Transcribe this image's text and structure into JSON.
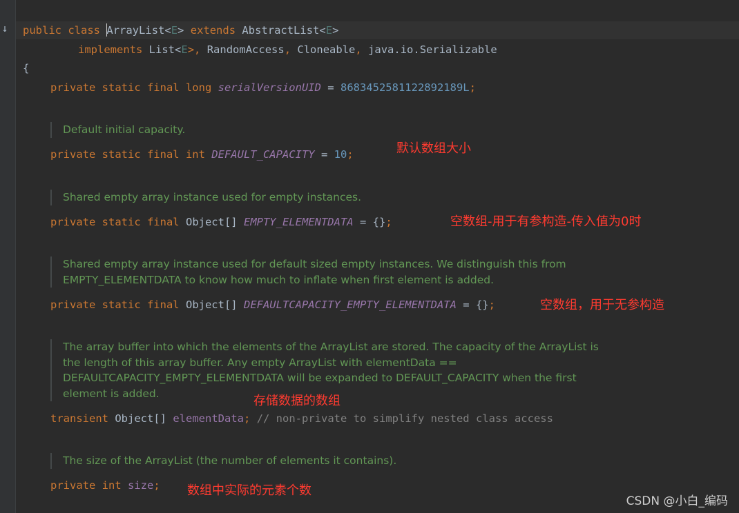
{
  "code": {
    "class_decl": {
      "public": "public",
      "class": "class",
      "name_first_char": "A",
      "name_rest": "rrayList",
      "lt1": "<",
      "type_param1": "E",
      "gt1": ">",
      "extends": "extends",
      "superclass": "AbstractList",
      "lt2": "<",
      "type_param2": "E",
      "gt2": ">"
    },
    "implements_line": {
      "implements": "implements",
      "list": "List",
      "lt": "<",
      "type_param": "E",
      "gt_comma": ">,",
      "random_access": "RandomAccess",
      "comma2": ",",
      "cloneable": "Cloneable",
      "comma3": ",",
      "serializable": "java.io.Serializable"
    },
    "open_brace": "{",
    "serial_line": {
      "modifiers": "private static final long",
      "name": "serialVersionUID",
      "eq": "=",
      "value": "8683452581122892189L",
      "semi": ";"
    },
    "doc_default_capacity": [
      "Default initial capacity."
    ],
    "default_capacity_line": {
      "modifiers": "private static final int",
      "name": "DEFAULT_CAPACITY",
      "eq": "=",
      "value": "10",
      "semi": ";"
    },
    "doc_empty": [
      "Shared empty array instance used for empty instances."
    ],
    "empty_line": {
      "modifiers": "private static final",
      "type": "Object[]",
      "name": "EMPTY_ELEMENTDATA",
      "eq": "=",
      "value": "{}",
      "semi": ";"
    },
    "doc_default_empty": [
      "Shared empty array instance used for default sized empty instances. We distinguish this from",
      "EMPTY_ELEMENTDATA to know how much to inflate when first element is added."
    ],
    "default_empty_line": {
      "modifiers": "private static final",
      "type": "Object[]",
      "name": "DEFAULTCAPACITY_EMPTY_ELEMENTDATA",
      "eq": "=",
      "value": "{}",
      "semi": ";"
    },
    "doc_element_data": [
      "The array buffer into which the elements of the ArrayList are stored. The capacity of the ArrayList is",
      "the length of this array buffer. Any empty ArrayList with elementData ==",
      "DEFAULTCAPACITY_EMPTY_ELEMENTDATA will be expanded to DEFAULT_CAPACITY when the first",
      "element is added."
    ],
    "element_data_line": {
      "modifier": "transient",
      "type": "Object[]",
      "name": "elementData",
      "semi": ";",
      "comment": "// non-private to simplify nested class access"
    },
    "doc_size": [
      "The size of the ArrayList (the number of elements it contains)."
    ],
    "size_line": {
      "modifiers": "private int",
      "name": "size",
      "semi": ";"
    }
  },
  "annotations": {
    "default_capacity": "默认数组大小",
    "empty_elementdata": "空数组-用于有参构造-传入值为0时",
    "default_empty": "空数组，用于无参构造",
    "element_data": "存储数据的数组",
    "size": "数组中实际的元素个数"
  },
  "gutter": {
    "icon": "implementation-down-arrow-icon",
    "glyph": "↓"
  },
  "watermark": "CSDN @小白_编码",
  "colors": {
    "background": "#2b2b2b",
    "keyword": "#cc7832",
    "field": "#9876aa",
    "number": "#6897bb",
    "javadoc": "#629755",
    "comment": "#808080",
    "annotation": "#ff3b30"
  }
}
